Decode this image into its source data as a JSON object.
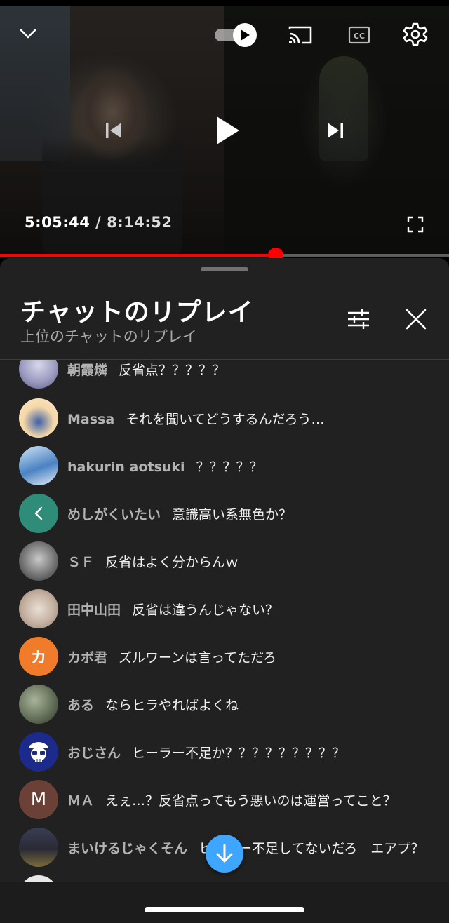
{
  "player": {
    "current_time": "5:05:44",
    "separator": " / ",
    "total_time": "8:14:52",
    "progress_fraction": 0.614,
    "icons": {
      "collapse": "chevron-down-icon",
      "autoplay": "autoplay-toggle-icon",
      "cast": "cast-icon",
      "captions": "cc-icon",
      "settings": "gear-icon",
      "previous": "skip-previous-icon",
      "play": "play-icon",
      "next": "skip-next-icon",
      "fullscreen": "fullscreen-icon"
    },
    "accent_color": "#ff0000"
  },
  "chat": {
    "title": "チャットのリプレイ",
    "subtitle": "上位のチャットのリプレイ",
    "icons": {
      "filter": "filter-sliders-icon",
      "close": "close-icon",
      "jump": "arrow-down-icon"
    },
    "jump_color": "#3ea6ff",
    "messages": [
      {
        "author": "朝霞燐",
        "text": "反省点？？？？？",
        "avatar_initial": ""
      },
      {
        "author": "Massa",
        "text": "それを聞いてどうするんだろう…",
        "avatar_initial": ""
      },
      {
        "author": "hakurin aotsuki",
        "text": "？？？？？",
        "avatar_initial": ""
      },
      {
        "author": "めしがくいたい",
        "text": "意識高い系無色か？",
        "avatar_initial": "<"
      },
      {
        "author": "ＳＦ",
        "text": "反省はよく分からんｗ",
        "avatar_initial": ""
      },
      {
        "author": "田中山田",
        "text": "反省は違うんじゃない？",
        "avatar_initial": ""
      },
      {
        "author": "カボ君",
        "text": "ズルワーンは言ってただろ",
        "avatar_initial": "カ"
      },
      {
        "author": "ある",
        "text": "ならヒラやればよくね",
        "avatar_initial": ""
      },
      {
        "author": "おじさん",
        "text": "ヒーラー不足か？？？？？？？？？",
        "avatar_initial": ""
      },
      {
        "author": "ＭＡ",
        "text": "えぇ…？反省点ってもう悪いのは運営ってこと？",
        "avatar_initial": "M"
      },
      {
        "author": "まいけるじゃくそん",
        "text": "ヒーラー不足してないだろ　エアプ？",
        "avatar_initial": ""
      }
    ]
  }
}
